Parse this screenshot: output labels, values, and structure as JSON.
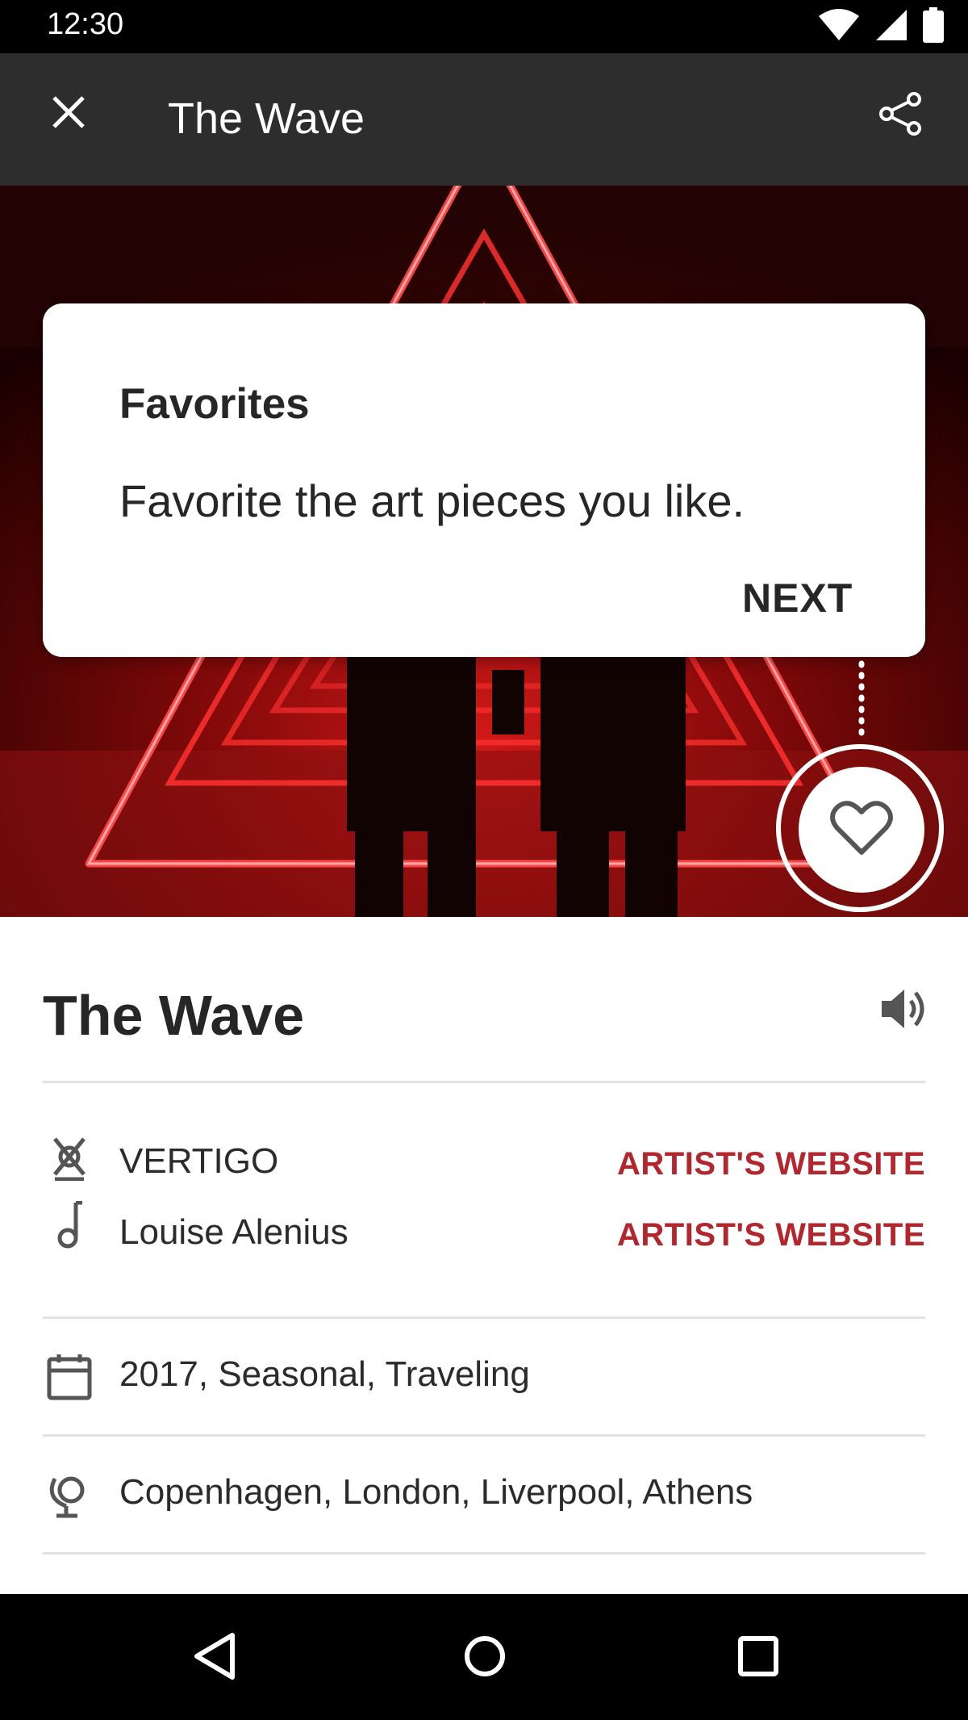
{
  "status_bar": {
    "time": "12:30",
    "icons": [
      "wifi-icon",
      "cell-signal-icon",
      "battery-icon"
    ]
  },
  "app_bar": {
    "title": "The Wave",
    "close_icon": "close-icon",
    "share_icon": "share-icon",
    "background": "#2d2d2d"
  },
  "tooltip": {
    "title": "Favorites",
    "body": "Favorite the art pieces you like.",
    "next_label": "NEXT"
  },
  "artwork": {
    "title": "The Wave",
    "sound_icon": "volume-icon",
    "artist": {
      "name": "VERTIGO",
      "link": "ARTIST'S WEBSITE",
      "icon": "artist-icon"
    },
    "composer": {
      "name": "Louise Alenius",
      "link": "ARTIST'S WEBSITE",
      "icon": "music-note-icon"
    },
    "details": "2017, Seasonal, Traveling",
    "locations": "Copenhagen, London, Liverpool, Athens"
  },
  "colors": {
    "accent": "#b3262d",
    "neon_red": "#ff2a2a",
    "text_dark": "#262626"
  },
  "nav_bar": {
    "icons": [
      "back-icon",
      "home-icon",
      "recents-icon"
    ]
  }
}
